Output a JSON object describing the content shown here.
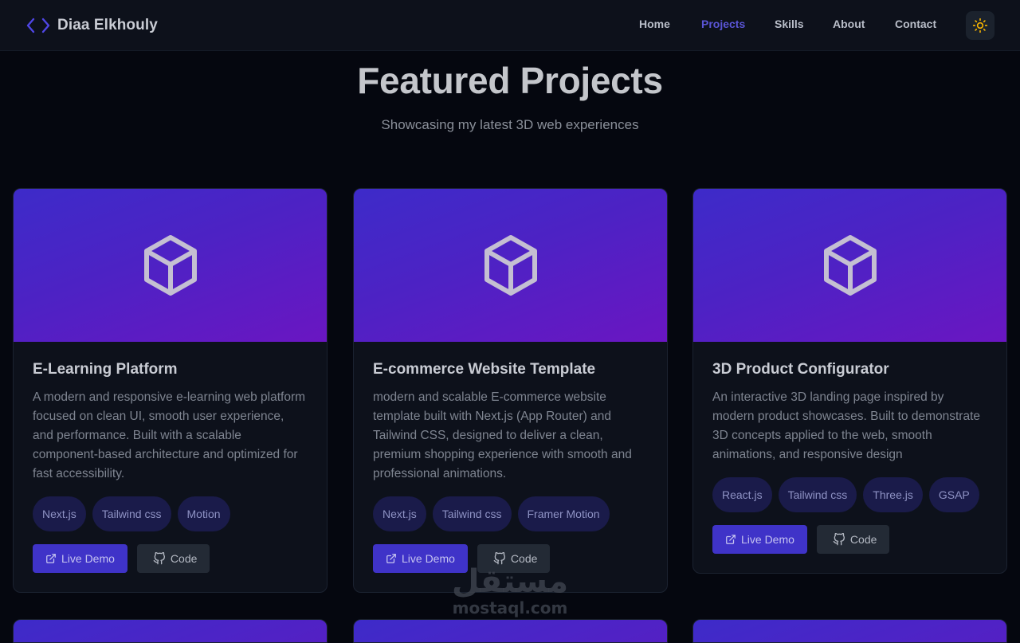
{
  "brand": {
    "name": "Diaa Elkhouly",
    "icon": "code-brackets-icon"
  },
  "nav": {
    "links": [
      {
        "label": "Home",
        "active": false
      },
      {
        "label": "Projects",
        "active": true
      },
      {
        "label": "Skills",
        "active": false
      },
      {
        "label": "About",
        "active": false
      },
      {
        "label": "Contact",
        "active": false
      }
    ],
    "theme_toggle_icon": "sun-icon"
  },
  "colors": {
    "background": "#05070f",
    "accent": "#5a55d6",
    "button_primary": "#3f33c8",
    "sun_icon": "#f2b100"
  },
  "header": {
    "title": "Featured Projects",
    "subtitle": "Showcasing my latest 3D web experiences"
  },
  "projects": [
    {
      "title": "E-Learning Platform",
      "description": "A modern and responsive e-learning web platform focused on clean UI, smooth user experience, and performance. Built with a scalable component-based architecture and optimized for fast accessibility.",
      "tags": [
        "Next.js",
        "Tailwind css",
        "Motion"
      ],
      "demo_label": "Live Demo",
      "code_label": "Code"
    },
    {
      "title": "E-commerce Website Template",
      "description": "modern and scalable E-commerce website template built with Next.js (App Router) and Tailwind CSS, designed to deliver a clean, premium shopping experience with smooth and professional animations.",
      "tags": [
        "Next.js",
        "Tailwind css",
        "Framer Motion"
      ],
      "demo_label": "Live Demo",
      "code_label": "Code"
    },
    {
      "title": "3D Product Configurator",
      "description": "An interactive 3D landing page inspired by modern product showcases. Built to demonstrate 3D concepts applied to the web, smooth animations, and responsive design",
      "tags": [
        "React.js",
        "Tailwind css",
        "Three.js",
        "GSAP"
      ],
      "demo_label": "Live Demo",
      "code_label": "Code"
    }
  ],
  "watermark": {
    "arabic": "مستقل",
    "latin": "mostaql.com"
  }
}
